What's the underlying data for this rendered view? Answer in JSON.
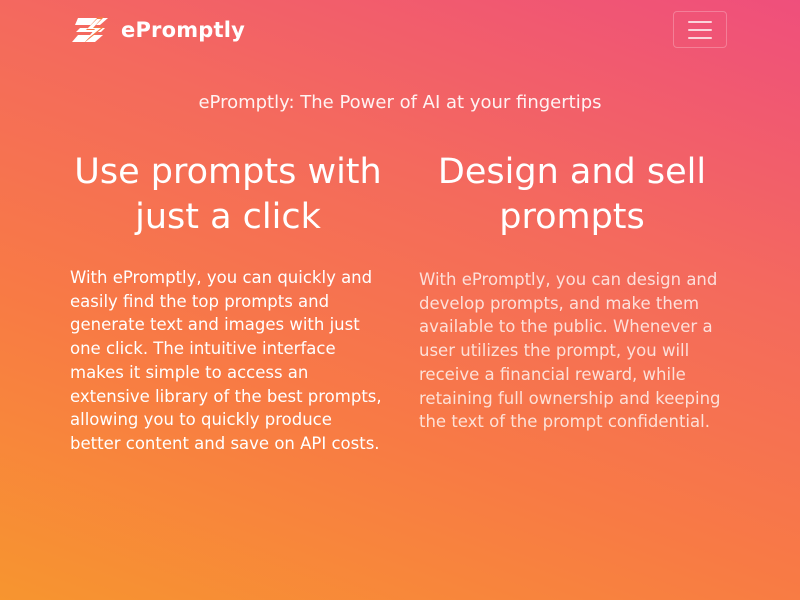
{
  "brand": {
    "name": "ePromptly",
    "logo_icon": "lightning-bolt-icon"
  },
  "navbar": {
    "menu_icon": "hamburger-menu-icon"
  },
  "hero": {
    "tagline": "ePromptly: The Power of AI at your fingertips"
  },
  "features": [
    {
      "title": "Use prompts with just a click",
      "body": "With ePromptly, you can quickly and easily find the top prompts and generate text and images with just one click. The intuitive interface makes it simple to access an extensive library of the best prompts, allowing you to quickly produce better content and save on API costs."
    },
    {
      "title": "Design and sell prompts",
      "body": "With ePromptly, you can design and develop prompts, and make them available to the public. Whenever a user utilizes the prompt, you will receive a financial reward, while retaining full ownership and keeping the text of the prompt confidential."
    }
  ],
  "colors": {
    "gradient_start": "#f7952f",
    "gradient_mid": "#f46a5d",
    "gradient_end": "#ef4f7c",
    "text": "#ffffff"
  }
}
